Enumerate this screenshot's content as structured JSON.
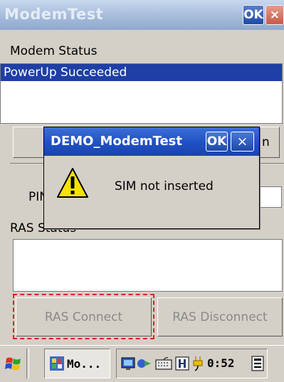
{
  "window": {
    "title": "ModemTest",
    "ok_label": "OK",
    "close_label": "×"
  },
  "modem_status": {
    "label": "Modem Status",
    "items": [
      "PowerUp Succeeded"
    ]
  },
  "partial_labels": {
    "button_right_fragment": "n",
    "pin_label_fragment": "PIN",
    "ras_status_label": "RAS Status"
  },
  "buttons": {
    "ras_connect": "RAS Connect",
    "ras_disconnect": "RAS Disconnect"
  },
  "dialog": {
    "title": "DEMO_ModemTest",
    "ok_label": "OK",
    "close_label": "×",
    "message": "SIM not inserted",
    "icon": "warning-icon"
  },
  "taskbar": {
    "task_label": "Mo...",
    "clock": "0:52"
  },
  "colors": {
    "selection": "#1f3fa6",
    "dialog_title": "#2050c4",
    "highlight_frame": "#d22222"
  }
}
